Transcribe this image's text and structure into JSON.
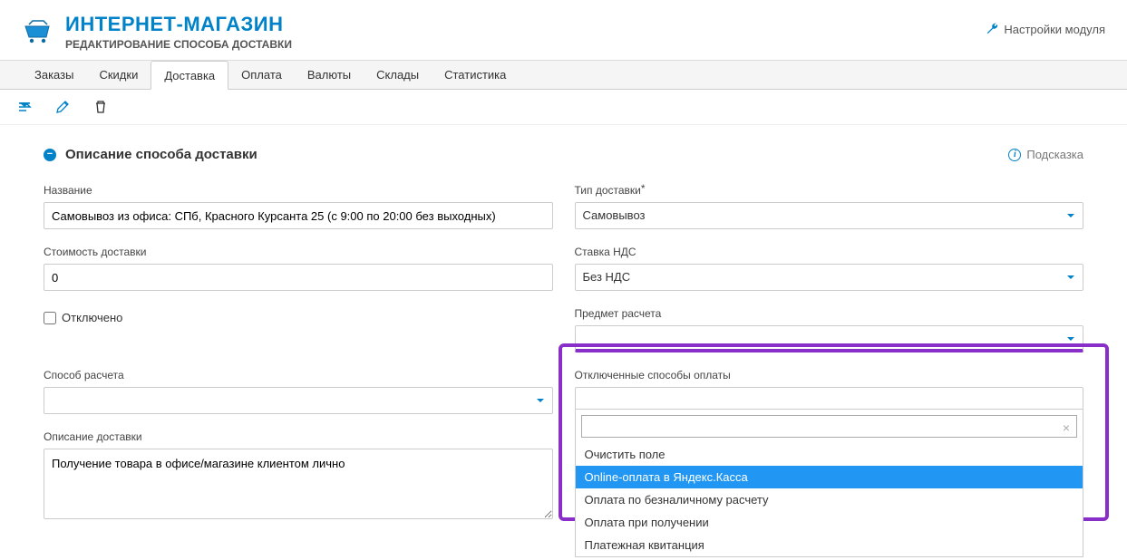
{
  "header": {
    "app_title": "ИНТЕРНЕТ-МАГАЗИН",
    "app_subtitle": "РЕДАКТИРОВАНИЕ СПОСОБА ДОСТАВКИ",
    "module_settings": "Настройки модуля"
  },
  "tabs": [
    "Заказы",
    "Скидки",
    "Доставка",
    "Оплата",
    "Валюты",
    "Склады",
    "Статистика"
  ],
  "active_tab_index": 2,
  "section": {
    "title": "Описание способа доставки",
    "hint": "Подсказка"
  },
  "fields": {
    "name_label": "Название",
    "name_value": "Самовывоз из офиса: СПб, Красного Курсанта 25 (с 9:00 по 20:00 без выходных)",
    "type_label": "Тип доставки",
    "type_value": "Самовывоз",
    "cost_label": "Стоимость доставки",
    "cost_value": "0",
    "vat_label": "Ставка НДС",
    "vat_value": "Без НДС",
    "disabled_label": "Отключено",
    "subject_label": "Предмет расчета",
    "method_label": "Способ расчета",
    "disabled_payments_label": "Отключенные способы оплаты",
    "desc_label": "Описание доставки",
    "desc_value": "Получение товара в офисе/магазине клиентом лично"
  },
  "dropdown": {
    "clear_field": "Очистить поле",
    "options": [
      "Online-оплата в Яндекс.Касса",
      "Оплата по безналичному расчету",
      "Оплата при получении",
      "Платежная квитанция"
    ],
    "highlighted_index": 0
  }
}
